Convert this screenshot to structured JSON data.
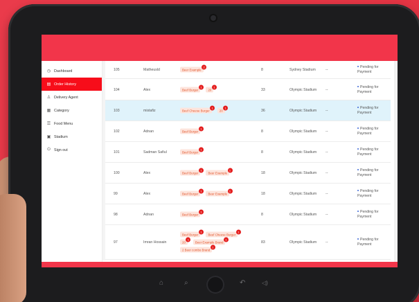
{
  "sidebar": {
    "items": [
      {
        "label": "Dashboard",
        "icon": "clock-icon",
        "active": false
      },
      {
        "label": "Order History",
        "icon": "history-icon",
        "active": true
      },
      {
        "label": "Delivery Agent",
        "icon": "user-icon",
        "active": false
      },
      {
        "label": "Category",
        "icon": "grid-icon",
        "active": false
      },
      {
        "label": "Food Menu",
        "icon": "menu-icon",
        "active": false
      },
      {
        "label": "Stadium",
        "icon": "stadium-icon",
        "active": false
      },
      {
        "label": "Sign out",
        "icon": "signout-icon",
        "active": false
      }
    ]
  },
  "orders": [
    {
      "id": "105",
      "name": "Matheusld",
      "items": [
        {
          "label": "Beer Example",
          "count": "2"
        }
      ],
      "qty": "8",
      "venue": "Sydney Stadium",
      "seat": "--",
      "status": "Pending for Payment",
      "highlight": false
    },
    {
      "id": "104",
      "name": "Alex",
      "items": [
        {
          "label": "Beef Burger",
          "count": "1"
        },
        {
          "label": "20",
          "count": "1"
        }
      ],
      "qty": "33",
      "venue": "Olympic Stadium",
      "seat": "--",
      "status": "Pending for Payment",
      "highlight": false
    },
    {
      "id": "103",
      "name": "mistafiz",
      "items": [
        {
          "label": "Beef Cheese Burger",
          "count": "1"
        },
        {
          "label": "20",
          "count": "1"
        }
      ],
      "qty": "36",
      "venue": "Olympic Stadium",
      "seat": "--",
      "status": "Pending for Payment",
      "highlight": true
    },
    {
      "id": "102",
      "name": "Adnan",
      "items": [
        {
          "label": "Beef Burger",
          "count": "1"
        }
      ],
      "qty": "8",
      "venue": "Olympic Stadium",
      "seat": "--",
      "status": "Pending for Payment",
      "highlight": false
    },
    {
      "id": "101",
      "name": "Sadman Safiul",
      "items": [
        {
          "label": "Beef Burger",
          "count": "1"
        }
      ],
      "qty": "8",
      "venue": "Olympic Stadium",
      "seat": "--",
      "status": "Pending for Payment",
      "highlight": false
    },
    {
      "id": "100",
      "name": "Alex",
      "items": [
        {
          "label": "Beef Burger",
          "count": "1"
        },
        {
          "label": "Beer Example",
          "count": "1"
        }
      ],
      "qty": "18",
      "venue": "Olympic Stadium",
      "seat": "--",
      "status": "Pending for Payment",
      "highlight": false
    },
    {
      "id": "99",
      "name": "Alex",
      "items": [
        {
          "label": "Beef Burger",
          "count": "1"
        },
        {
          "label": "Beer Example",
          "count": "1"
        }
      ],
      "qty": "18",
      "venue": "Olympic Stadium",
      "seat": "--",
      "status": "Pending for Payment",
      "highlight": false
    },
    {
      "id": "98",
      "name": "Adnan",
      "items": [
        {
          "label": "Beef Burger",
          "count": "1"
        }
      ],
      "qty": "8",
      "venue": "Olympic Stadium",
      "seat": "--",
      "status": "Pending for Payment",
      "highlight": false
    },
    {
      "id": "97",
      "name": "Imran Hossain",
      "items": [
        {
          "label": "Beef Burger",
          "count": "1"
        },
        {
          "label": "Beef Cheese Burger",
          "count": "1"
        },
        {
          "label": "20",
          "count": "1"
        },
        {
          "label": "Beer Example Brand",
          "count": "1"
        },
        {
          "label": "2 Beer combo Brand",
          "count": "1"
        }
      ],
      "qty": "83",
      "venue": "Olympic Stadium",
      "seat": "--",
      "status": "Pending for Payment",
      "highlight": false
    }
  ],
  "colors": {
    "accent": "#f2354a",
    "active": "#f70d1a",
    "highlight": "#e0f3fb",
    "tag_bg": "#fde4dc",
    "badge": "#e41d1d"
  }
}
